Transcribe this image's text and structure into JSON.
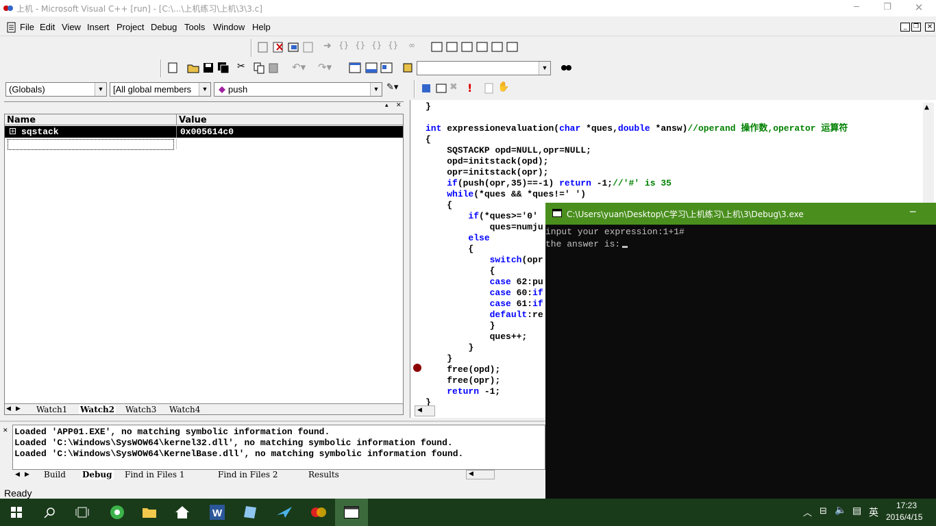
{
  "app": {
    "title": "上机 - Microsoft Visual C++ [run] - [C:\\...\\上机练习\\上机\\3\\3.c]"
  },
  "menu": [
    "File",
    "Edit",
    "View",
    "Insert",
    "Project",
    "Debug",
    "Tools",
    "Window",
    "Help"
  ],
  "toolbar": {
    "find_combo_value": ""
  },
  "wizard": {
    "scope": "(Globals)",
    "members": "[All global members",
    "function": "push"
  },
  "watch": {
    "headers": {
      "name": "Name",
      "value": "Value"
    },
    "rows": [
      {
        "name": "sqstack",
        "value": "0x005614c0"
      }
    ],
    "tabs": [
      "Watch1",
      "Watch2",
      "Watch3",
      "Watch4"
    ],
    "active_tab": "Watch2"
  },
  "code": {
    "lines": [
      "}",
      "",
      "int expressionevaluation(char *ques,double *answ)//operand 操作数,operator 运算符",
      "{",
      "    SQSTACKP opd=NULL,opr=NULL;",
      "    opd=initstack(opd);",
      "    opr=initstack(opr);",
      "    if(push(opr,35)==-1) return -1;//'#' is 35",
      "    while(*ques && *ques!=' ')",
      "    {",
      "        if(*ques>='0'",
      "            ques=numju",
      "        else",
      "        {",
      "            switch(opr",
      "            {",
      "            case 62:pu",
      "            case 60:if",
      "            case 61:if",
      "            default:re",
      "            }",
      "            ques++;",
      "        }",
      "    }",
      "    free(opd);",
      "    free(opr);",
      "    return -1;",
      "}"
    ]
  },
  "output": {
    "lines": [
      "Loaded 'APP01.EXE', no matching symbolic information found.",
      "Loaded 'C:\\Windows\\SysWOW64\\kernel32.dll', no matching symbolic information found.",
      "Loaded 'C:\\Windows\\SysWOW64\\KernelBase.dll', no matching symbolic information found."
    ],
    "tabs": [
      "Build",
      "Debug",
      "Find in Files 1",
      "Find in Files 2",
      "Results"
    ],
    "active_tab": "Debug"
  },
  "status": {
    "text": "Ready"
  },
  "console": {
    "title": "C:\\Users\\yuan\\Desktop\\C学习\\上机练习\\上机\\3\\Debug\\3.exe",
    "lines": [
      "input your expression:1+1#",
      "the answer is:"
    ]
  },
  "taskbar": {
    "time": "17:23",
    "date": "2016/4/15",
    "ime": "英"
  },
  "colors": {
    "keyword": "#0000ff",
    "comment": "#008000",
    "breakpoint": "#8b0000",
    "console_title": "#4a8f1e",
    "taskbar": "#1a3b1a"
  }
}
